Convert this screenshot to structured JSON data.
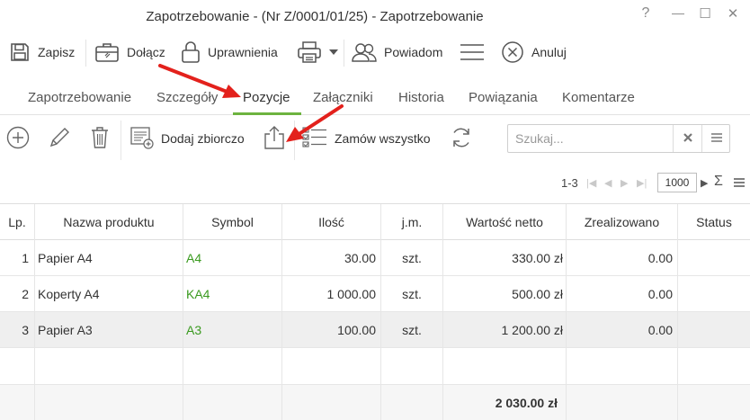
{
  "window": {
    "title": "Zapotrzebowanie - (Nr Z/0001/01/25) - Zapotrzebowanie",
    "help": "?",
    "minimize": "—",
    "maximize": "☐",
    "close": "✕"
  },
  "toolbar": {
    "save": "Zapisz",
    "attach": "Dołącz",
    "permissions": "Uprawnienia",
    "notify": "Powiadom",
    "cancel": "Anuluj"
  },
  "tabs": [
    {
      "label": "Zapotrzebowanie"
    },
    {
      "label": "Szczegóły"
    },
    {
      "label": "Pozycje",
      "active": true
    },
    {
      "label": "Załączniki"
    },
    {
      "label": "Historia"
    },
    {
      "label": "Powiązania"
    },
    {
      "label": "Komentarze"
    }
  ],
  "subtoolbar": {
    "bulk_add": "Dodaj zbiorczo",
    "order_all": "Zamów wszystko"
  },
  "search": {
    "placeholder": "Szukaj..."
  },
  "pager": {
    "range": "1-3",
    "page_size": "1000"
  },
  "table": {
    "columns": [
      "Lp.",
      "Nazwa produktu",
      "Symbol",
      "Ilość",
      "j.m.",
      "Wartość netto",
      "Zrealizowano",
      "Status"
    ],
    "rows": [
      {
        "lp": "1",
        "name": "Papier A4",
        "symbol": "A4",
        "qty": "30.00",
        "unit": "szt.",
        "net": "330.00 zł",
        "done": "0.00",
        "status": ""
      },
      {
        "lp": "2",
        "name": "Koperty A4",
        "symbol": "KA4",
        "qty": "1 000.00",
        "unit": "szt.",
        "net": "500.00 zł",
        "done": "0.00",
        "status": ""
      },
      {
        "lp": "3",
        "name": "Papier A3",
        "symbol": "A3",
        "qty": "100.00",
        "unit": "szt.",
        "net": "1 200.00 zł",
        "done": "0.00",
        "status": ""
      }
    ],
    "total_net": "2 030.00 zł"
  },
  "colors": {
    "accent": "#6db33f",
    "symbol_text": "#3a9a1f",
    "annotation_arrow": "#e3211c"
  },
  "icons": [
    "save-icon",
    "briefcase-icon",
    "lock-icon",
    "printer-icon",
    "users-icon",
    "menu-icon",
    "cancel-icon",
    "plus-icon",
    "pencil-icon",
    "trash-icon",
    "bulk-add-icon",
    "export-icon",
    "checklist-icon",
    "refresh-icon",
    "clear-icon",
    "list-icon",
    "sum-icon"
  ]
}
